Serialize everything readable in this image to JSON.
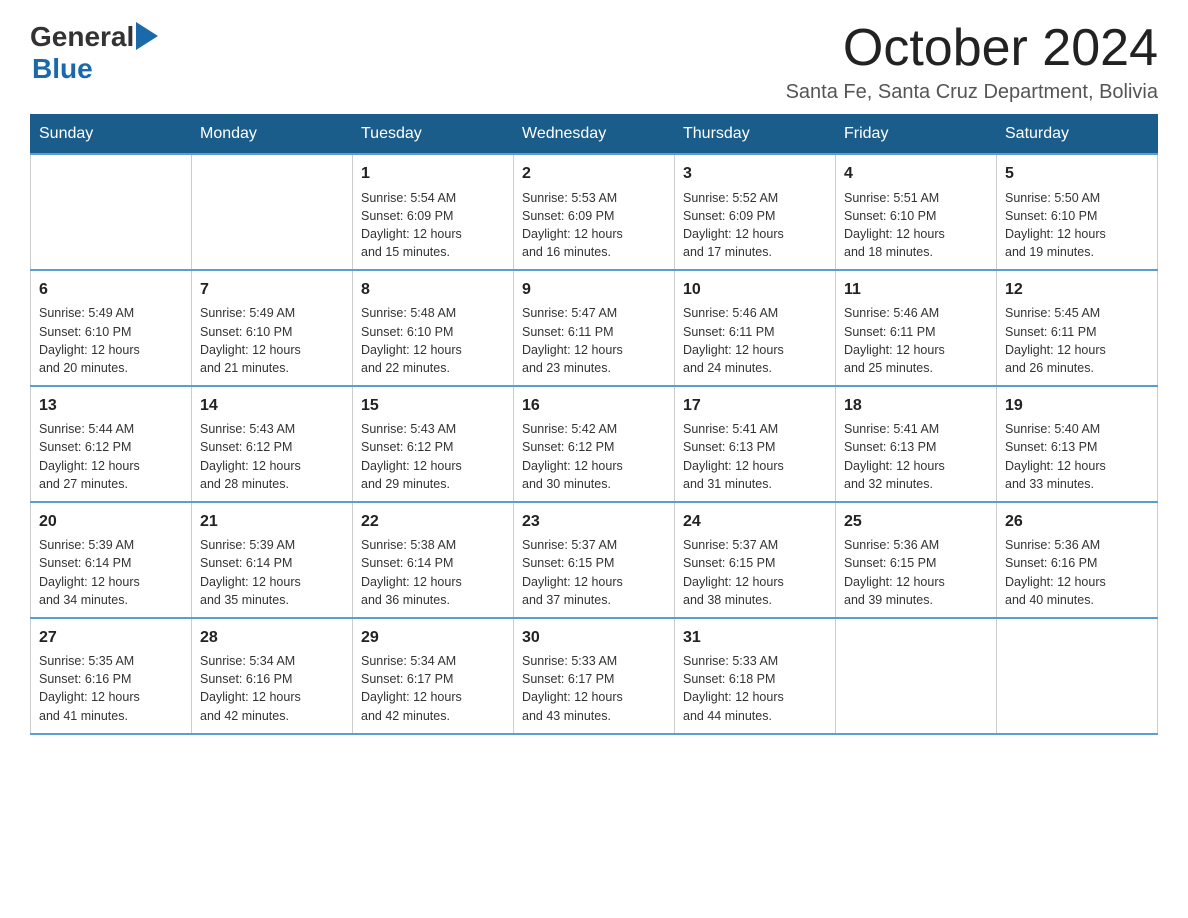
{
  "header": {
    "logo_general": "General",
    "logo_blue": "Blue",
    "month_title": "October 2024",
    "location": "Santa Fe, Santa Cruz Department, Bolivia"
  },
  "weekdays": [
    "Sunday",
    "Monday",
    "Tuesday",
    "Wednesday",
    "Thursday",
    "Friday",
    "Saturday"
  ],
  "weeks": [
    [
      {
        "day": "",
        "info": ""
      },
      {
        "day": "",
        "info": ""
      },
      {
        "day": "1",
        "info": "Sunrise: 5:54 AM\nSunset: 6:09 PM\nDaylight: 12 hours\nand 15 minutes."
      },
      {
        "day": "2",
        "info": "Sunrise: 5:53 AM\nSunset: 6:09 PM\nDaylight: 12 hours\nand 16 minutes."
      },
      {
        "day": "3",
        "info": "Sunrise: 5:52 AM\nSunset: 6:09 PM\nDaylight: 12 hours\nand 17 minutes."
      },
      {
        "day": "4",
        "info": "Sunrise: 5:51 AM\nSunset: 6:10 PM\nDaylight: 12 hours\nand 18 minutes."
      },
      {
        "day": "5",
        "info": "Sunrise: 5:50 AM\nSunset: 6:10 PM\nDaylight: 12 hours\nand 19 minutes."
      }
    ],
    [
      {
        "day": "6",
        "info": "Sunrise: 5:49 AM\nSunset: 6:10 PM\nDaylight: 12 hours\nand 20 minutes."
      },
      {
        "day": "7",
        "info": "Sunrise: 5:49 AM\nSunset: 6:10 PM\nDaylight: 12 hours\nand 21 minutes."
      },
      {
        "day": "8",
        "info": "Sunrise: 5:48 AM\nSunset: 6:10 PM\nDaylight: 12 hours\nand 22 minutes."
      },
      {
        "day": "9",
        "info": "Sunrise: 5:47 AM\nSunset: 6:11 PM\nDaylight: 12 hours\nand 23 minutes."
      },
      {
        "day": "10",
        "info": "Sunrise: 5:46 AM\nSunset: 6:11 PM\nDaylight: 12 hours\nand 24 minutes."
      },
      {
        "day": "11",
        "info": "Sunrise: 5:46 AM\nSunset: 6:11 PM\nDaylight: 12 hours\nand 25 minutes."
      },
      {
        "day": "12",
        "info": "Sunrise: 5:45 AM\nSunset: 6:11 PM\nDaylight: 12 hours\nand 26 minutes."
      }
    ],
    [
      {
        "day": "13",
        "info": "Sunrise: 5:44 AM\nSunset: 6:12 PM\nDaylight: 12 hours\nand 27 minutes."
      },
      {
        "day": "14",
        "info": "Sunrise: 5:43 AM\nSunset: 6:12 PM\nDaylight: 12 hours\nand 28 minutes."
      },
      {
        "day": "15",
        "info": "Sunrise: 5:43 AM\nSunset: 6:12 PM\nDaylight: 12 hours\nand 29 minutes."
      },
      {
        "day": "16",
        "info": "Sunrise: 5:42 AM\nSunset: 6:12 PM\nDaylight: 12 hours\nand 30 minutes."
      },
      {
        "day": "17",
        "info": "Sunrise: 5:41 AM\nSunset: 6:13 PM\nDaylight: 12 hours\nand 31 minutes."
      },
      {
        "day": "18",
        "info": "Sunrise: 5:41 AM\nSunset: 6:13 PM\nDaylight: 12 hours\nand 32 minutes."
      },
      {
        "day": "19",
        "info": "Sunrise: 5:40 AM\nSunset: 6:13 PM\nDaylight: 12 hours\nand 33 minutes."
      }
    ],
    [
      {
        "day": "20",
        "info": "Sunrise: 5:39 AM\nSunset: 6:14 PM\nDaylight: 12 hours\nand 34 minutes."
      },
      {
        "day": "21",
        "info": "Sunrise: 5:39 AM\nSunset: 6:14 PM\nDaylight: 12 hours\nand 35 minutes."
      },
      {
        "day": "22",
        "info": "Sunrise: 5:38 AM\nSunset: 6:14 PM\nDaylight: 12 hours\nand 36 minutes."
      },
      {
        "day": "23",
        "info": "Sunrise: 5:37 AM\nSunset: 6:15 PM\nDaylight: 12 hours\nand 37 minutes."
      },
      {
        "day": "24",
        "info": "Sunrise: 5:37 AM\nSunset: 6:15 PM\nDaylight: 12 hours\nand 38 minutes."
      },
      {
        "day": "25",
        "info": "Sunrise: 5:36 AM\nSunset: 6:15 PM\nDaylight: 12 hours\nand 39 minutes."
      },
      {
        "day": "26",
        "info": "Sunrise: 5:36 AM\nSunset: 6:16 PM\nDaylight: 12 hours\nand 40 minutes."
      }
    ],
    [
      {
        "day": "27",
        "info": "Sunrise: 5:35 AM\nSunset: 6:16 PM\nDaylight: 12 hours\nand 41 minutes."
      },
      {
        "day": "28",
        "info": "Sunrise: 5:34 AM\nSunset: 6:16 PM\nDaylight: 12 hours\nand 42 minutes."
      },
      {
        "day": "29",
        "info": "Sunrise: 5:34 AM\nSunset: 6:17 PM\nDaylight: 12 hours\nand 42 minutes."
      },
      {
        "day": "30",
        "info": "Sunrise: 5:33 AM\nSunset: 6:17 PM\nDaylight: 12 hours\nand 43 minutes."
      },
      {
        "day": "31",
        "info": "Sunrise: 5:33 AM\nSunset: 6:18 PM\nDaylight: 12 hours\nand 44 minutes."
      },
      {
        "day": "",
        "info": ""
      },
      {
        "day": "",
        "info": ""
      }
    ]
  ]
}
